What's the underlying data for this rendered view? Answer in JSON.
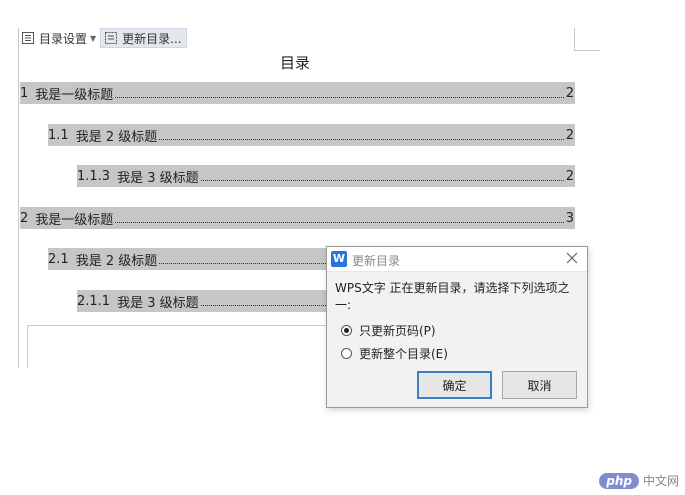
{
  "toolbar": {
    "toc_settings_label": "目录设置",
    "update_toc_label": "更新目录..."
  },
  "document": {
    "toc_title": "目录",
    "entries": [
      {
        "number": "1",
        "text": "我是一级标题",
        "page": "2"
      },
      {
        "number": "1.1",
        "text": "我是 2 级标题",
        "page": "2"
      },
      {
        "number": "1.1.3",
        "text": "我是 3 级标题",
        "page": "2"
      },
      {
        "number": "2",
        "text": "我是一级标题",
        "page": "3"
      },
      {
        "number": "2.1",
        "text": "我是 2 级标题",
        "page": ""
      },
      {
        "number": "2.1.1",
        "text": "我是 3 级标题",
        "page": ""
      }
    ]
  },
  "dialog": {
    "logo_letter": "W",
    "title": "更新目录",
    "message": "WPS文字 正在更新目录，请选择下列选项之一:",
    "options": [
      {
        "label": "只更新页码(P)",
        "selected": true
      },
      {
        "label": "更新整个目录(E)",
        "selected": false
      }
    ],
    "ok_label": "确定",
    "cancel_label": "取消"
  },
  "watermark": {
    "badge": "php",
    "text": "中文网"
  },
  "colors": {
    "toc_highlight": "#c6c6c6",
    "dialog_bg": "#f2f2f2",
    "accent_blue": "#3d7ec4",
    "wps_logo": "#2a73d9"
  }
}
